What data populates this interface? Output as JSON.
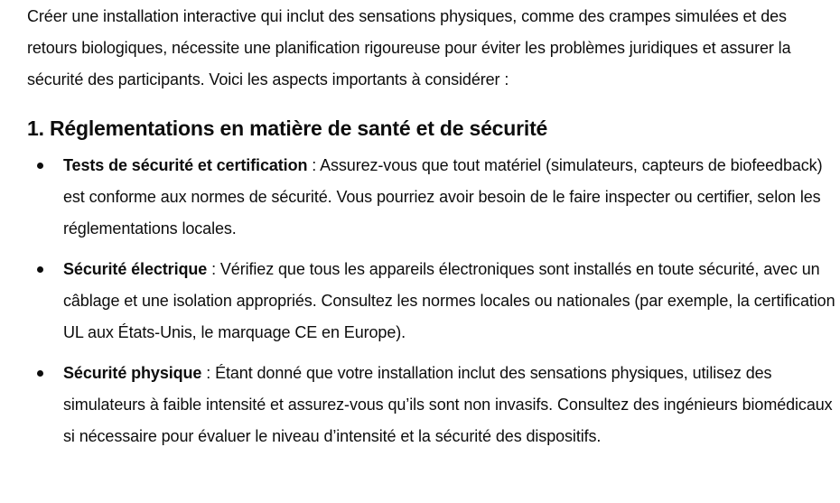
{
  "intro": "Créer une installation interactive qui inclut des sensations physiques, comme des crampes simulées et des retours biologiques, nécessite une planification rigoureuse pour éviter les problèmes juridiques et assurer la sécurité des participants. Voici les aspects importants à considérer :",
  "section": {
    "title": "1. Réglementations en matière de santé et de sécurité",
    "items": [
      {
        "term": "Tests de sécurité et certification",
        "separator": " : ",
        "text": "Assurez-vous que tout matériel (simulateurs, capteurs de biofeedback) est conforme aux normes de sécurité. Vous pourriez avoir besoin de le faire inspecter ou certifier, selon les réglementations locales."
      },
      {
        "term": "Sécurité électrique",
        "separator": " : ",
        "text": "Vérifiez que tous les appareils électroniques sont installés en toute sécurité, avec un câblage et une isolation appropriés. Consultez les normes locales ou nationales (par exemple, la certification UL aux États-Unis, le marquage CE en Europe)."
      },
      {
        "term": "Sécurité physique",
        "separator": " : ",
        "text": "Étant donné que votre installation inclut des sensations physiques, utilisez des simulateurs à faible intensité et assurez-vous qu’ils sont non invasifs. Consultez des ingénieurs biomédicaux si nécessaire pour évaluer le niveau d’intensité et la sécurité des dispositifs."
      }
    ]
  }
}
